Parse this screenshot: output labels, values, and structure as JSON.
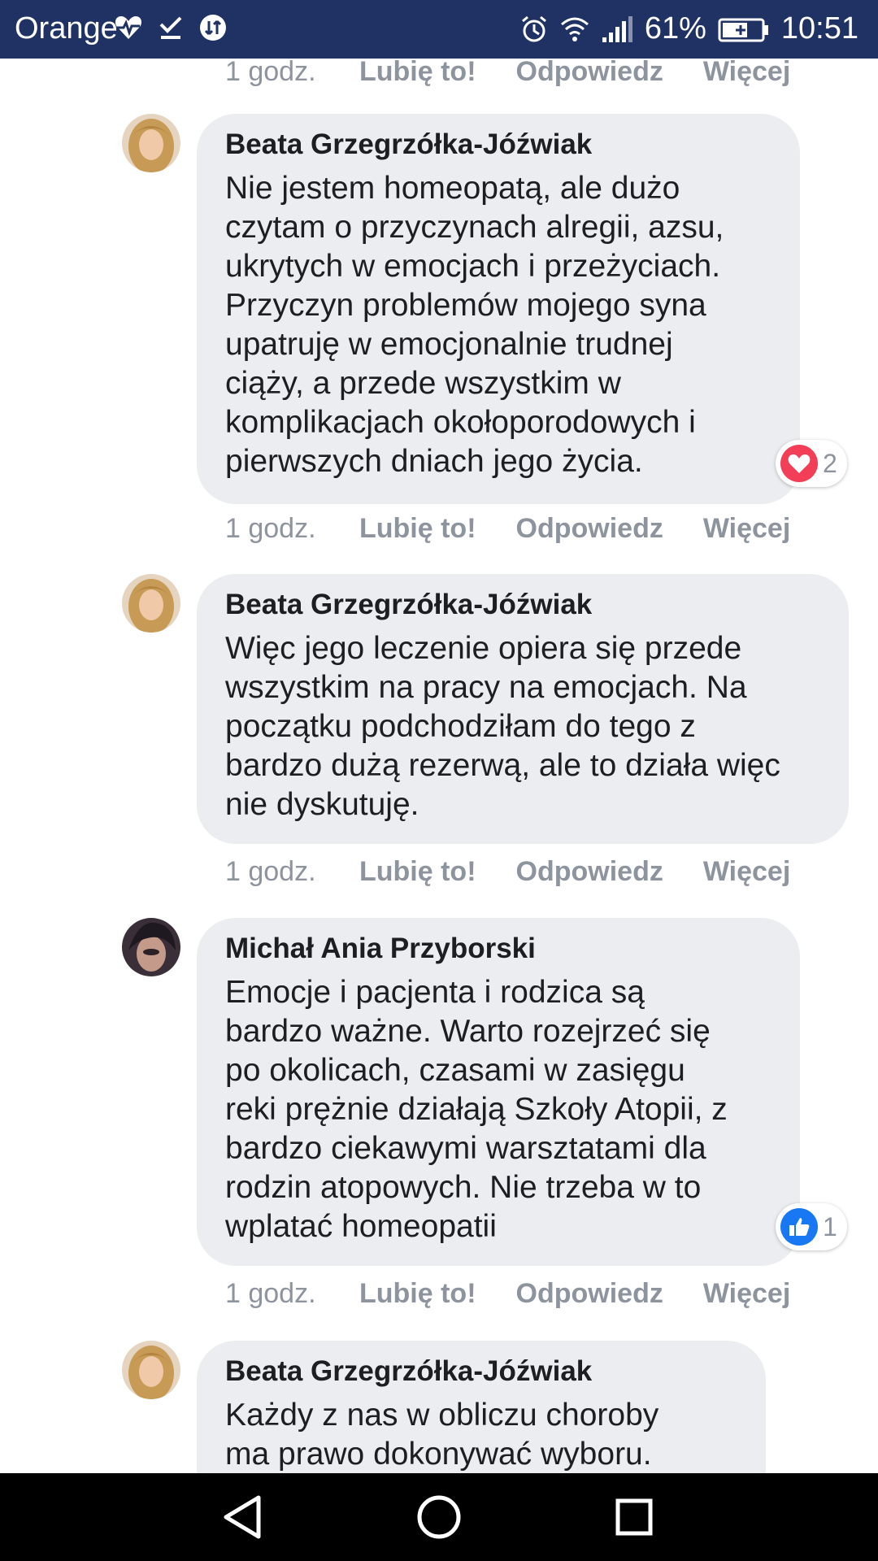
{
  "status_bar": {
    "carrier": "Orange",
    "battery": "61%",
    "time": "10:51",
    "icons": [
      "heartbeat-icon",
      "check-icon",
      "data-saver-icon",
      "alarm-icon",
      "wifi-icon",
      "signal-icon",
      "battery-icon"
    ]
  },
  "top_actions": {
    "time": "1 godz.",
    "like": "Lubię to!",
    "reply": "Odpowiedz",
    "more": "Więcej"
  },
  "comments": [
    {
      "author": "Beata Grzegrzółka-Jóźwiak",
      "lines": [
        "Nie jestem homeopatą, ale dużo",
        "czytam o przyczynach alregii, azsu,",
        "ukrytych w emocjach i przeżyciach.",
        "Przyczyn problemów mojego syna",
        "upatruję w emocjonalnie trudnej",
        "ciąży, a przede wszystkim w",
        "komplikacjach okołoporodowych i",
        "pierwszych dniach jego życia."
      ],
      "reaction": {
        "type": "heart-icon",
        "count": "2",
        "color": "#f33e58"
      },
      "time": "1 godz.",
      "like": "Lubię to!",
      "reply": "Odpowiedz",
      "more": "Więcej"
    },
    {
      "author": "Beata Grzegrzółka-Jóźwiak",
      "lines": [
        "Więc jego leczenie opiera się przede",
        "wszystkim na pracy na emocjach. Na",
        "początku podchodziłam do tego z",
        "bardzo dużą rezerwą, ale to działa więc",
        "nie dyskutuję."
      ],
      "time": "1 godz.",
      "like": "Lubię to!",
      "reply": "Odpowiedz",
      "more": "Więcej"
    },
    {
      "author": "Michał Ania Przyborski",
      "lines": [
        "Emocje i pacjenta i rodzica są",
        "bardzo ważne. Warto rozejrzeć się",
        "po okolicach, czasami w zasięgu",
        "reki prężnie działają Szkoły Atopii, z",
        "bardzo ciekawymi warsztatami dla",
        "rodzin atopowych. Nie trzeba w to",
        "wplatać homeopatii"
      ],
      "reaction": {
        "type": "thumbs-up-icon",
        "count": "1",
        "color": "#1877f2"
      },
      "time": "1 godz.",
      "like": "Lubię to!",
      "reply": "Odpowiedz",
      "more": "Więcej"
    },
    {
      "author": "Beata Grzegrzółka-Jóźwiak",
      "lines": [
        "Każdy z nas w obliczu choroby",
        "ma prawo dokonywać wyboru."
      ]
    }
  ],
  "nav_bar": {
    "icons": [
      "back-icon",
      "home-icon",
      "recents-icon"
    ]
  }
}
